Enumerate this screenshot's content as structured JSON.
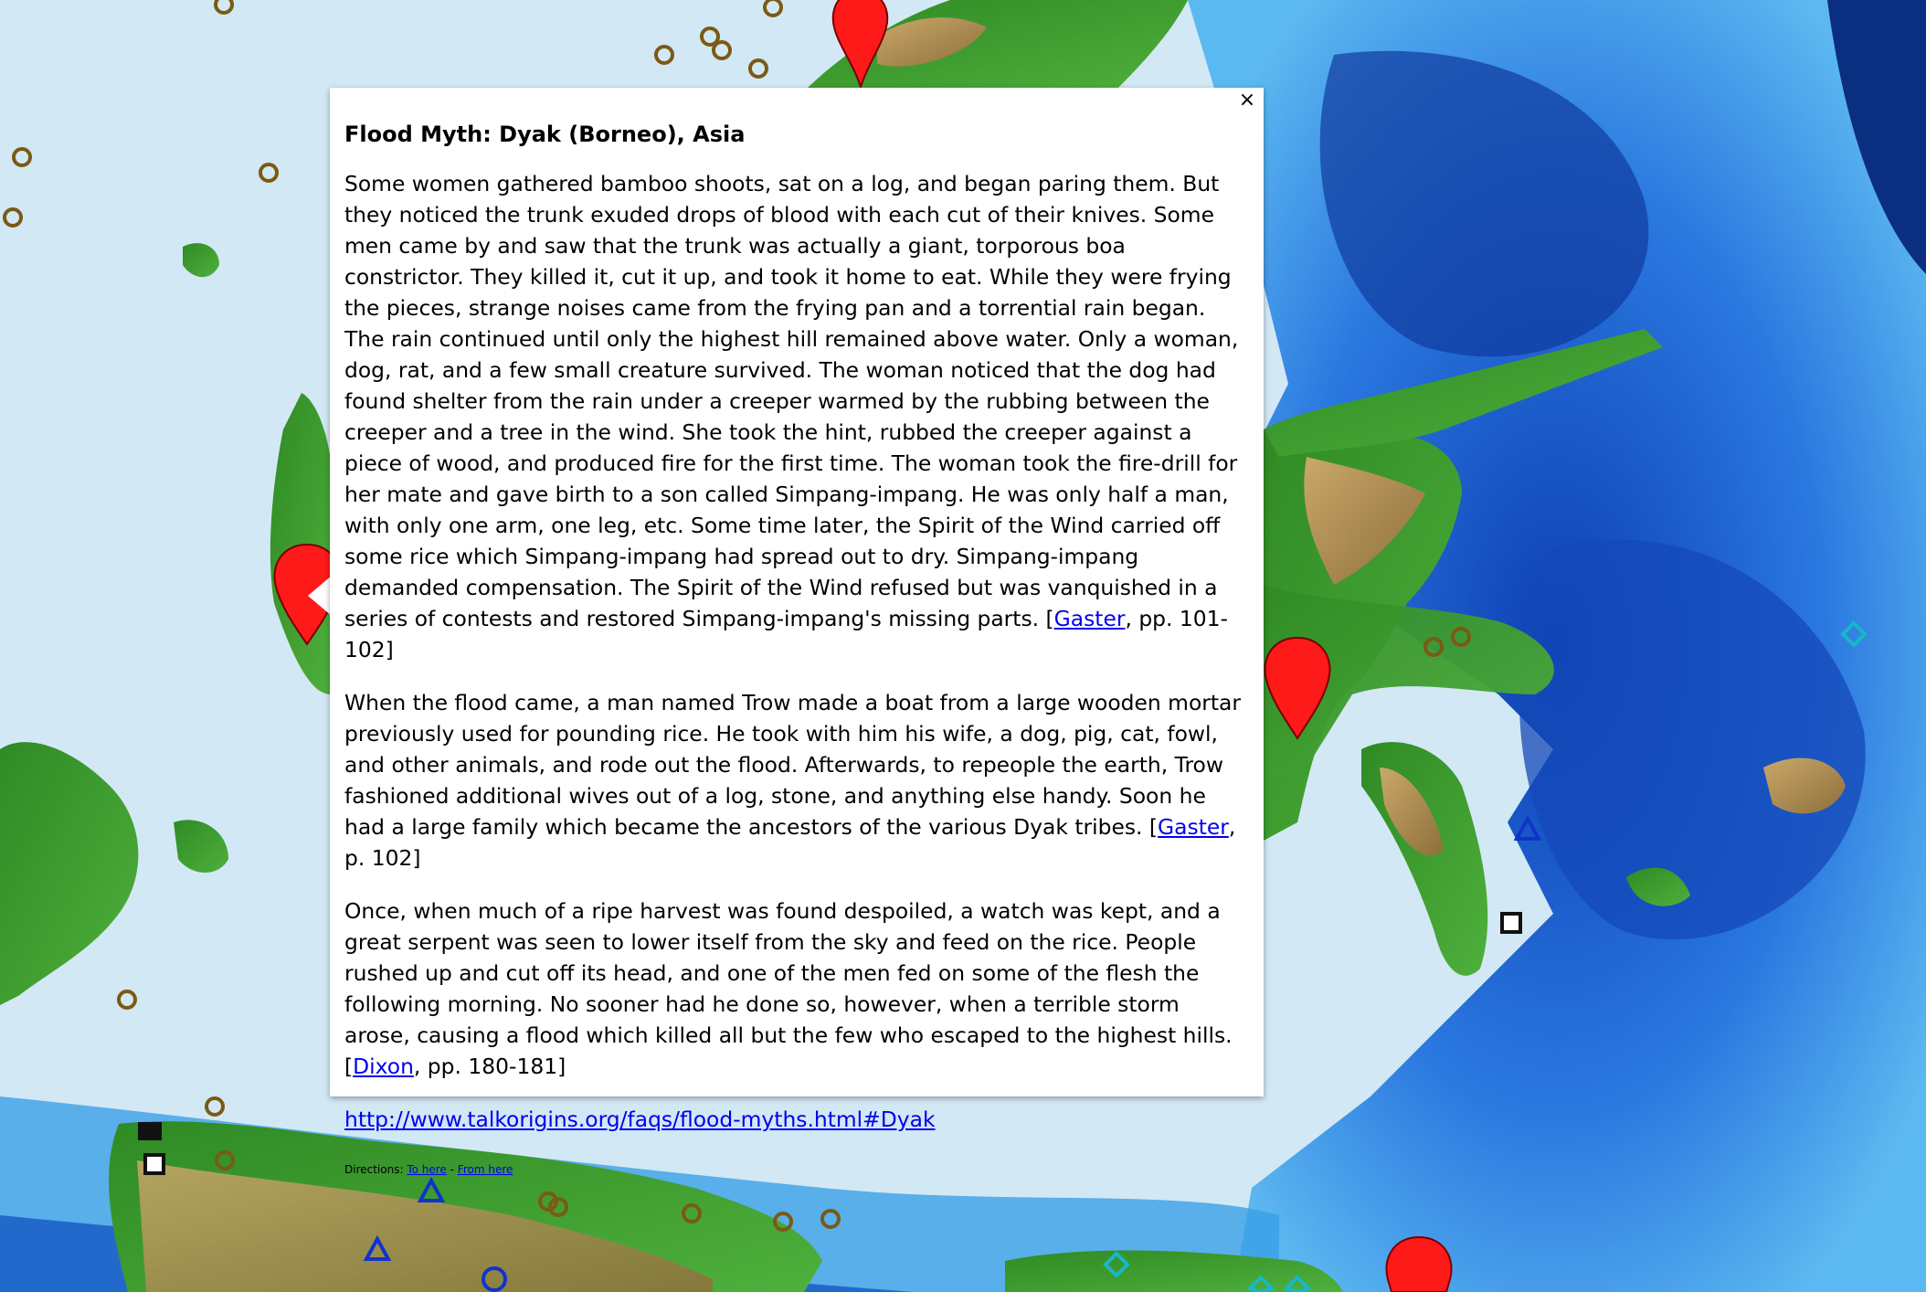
{
  "infowindow": {
    "title": "Flood Myth: Dyak (Borneo), Asia",
    "close_label": "×",
    "paragraphs": [
      {
        "text": "Some women gathered bamboo shoots, sat on a log, and began paring them. But they noticed the trunk exuded drops of blood with each cut of their knives. Some men came by and saw that the trunk was actually a giant, torporous boa constrictor. They killed it, cut it up, and took it home to eat. While they were frying the pieces, strange noises came from the frying pan and a torrential rain began. The rain continued until only the highest hill remained above water. Only a woman, dog, rat, and a few small creature survived. The woman noticed that the dog had found shelter from the rain under a creeper warmed by the rubbing between the creeper and a tree in the wind. She took the hint, rubbed the creeper against a piece of wood, and produced fire for the first time. The woman took the fire-drill for her mate and gave birth to a son called Simpang-impang. He was only half a man, with only one arm, one leg, etc. Some time later, the Spirit of the Wind carried off some rice which Simpang-impang had spread out to dry. Simpang-impang demanded compensation. The Spirit of the Wind refused but was vanquished in a series of contests and restored Simpang-impang's missing parts. [",
        "ref": "Gaster",
        "pages": ", pp. 101-102]"
      },
      {
        "text": "When the flood came, a man named Trow made a boat from a large wooden mortar previously used for pounding rice. He took with him his wife, a dog, pig, cat, fowl, and other animals, and rode out the flood. Afterwards, to repeople the earth, Trow fashioned additional wives out of a log, stone, and anything else handy. Soon he had a large family which became the ancestors of the various Dyak tribes. [",
        "ref": "Gaster",
        "pages": ", p. 102]"
      },
      {
        "text": "Once, when much of a ripe harvest was found despoiled, a watch was kept, and a great serpent was seen to lower itself from the sky and feed on the rice. People rushed up and cut off its head, and one of the men fed on some of the flesh the following morning. No sooner had he done so, however, when a terrible storm arose, causing a flood which killed all but the few who escaped to the highest hills. [",
        "ref": "Dixon",
        "pages": ", pp. 180-181]"
      }
    ],
    "url": "http://www.talkorigins.org/faqs/flood-myths.html#Dyak",
    "directions": {
      "prefix": "Directions: ",
      "to_here": "To here",
      "separator": " - ",
      "from_here": "From here"
    }
  },
  "colors": {
    "shallow_sea": "#d6ebf5",
    "deep_sea": "#1a5fcf",
    "land": "#3f9a2e",
    "highland": "#b79a5b",
    "marker_red": "#ff1a1a",
    "ring_marker": "#7a5a14",
    "triangle_marker": "#1133cc",
    "diamond_marker": "#18b7c8"
  }
}
